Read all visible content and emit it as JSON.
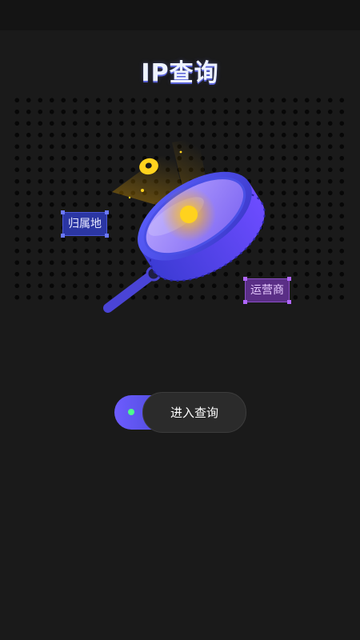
{
  "app": {
    "title": "IP查询"
  },
  "illustration": {
    "tag_region": "归属地",
    "tag_carrier": "运营商",
    "icon": "magnifier-lens-icon"
  },
  "action": {
    "enter_label": "进入查询"
  },
  "colors": {
    "background": "#1a1a1a",
    "accent_blue": "#4a4ad6",
    "accent_purple": "#7c5cff",
    "glow_yellow": "#ffd21e",
    "indicator_green": "#4dff8c"
  }
}
